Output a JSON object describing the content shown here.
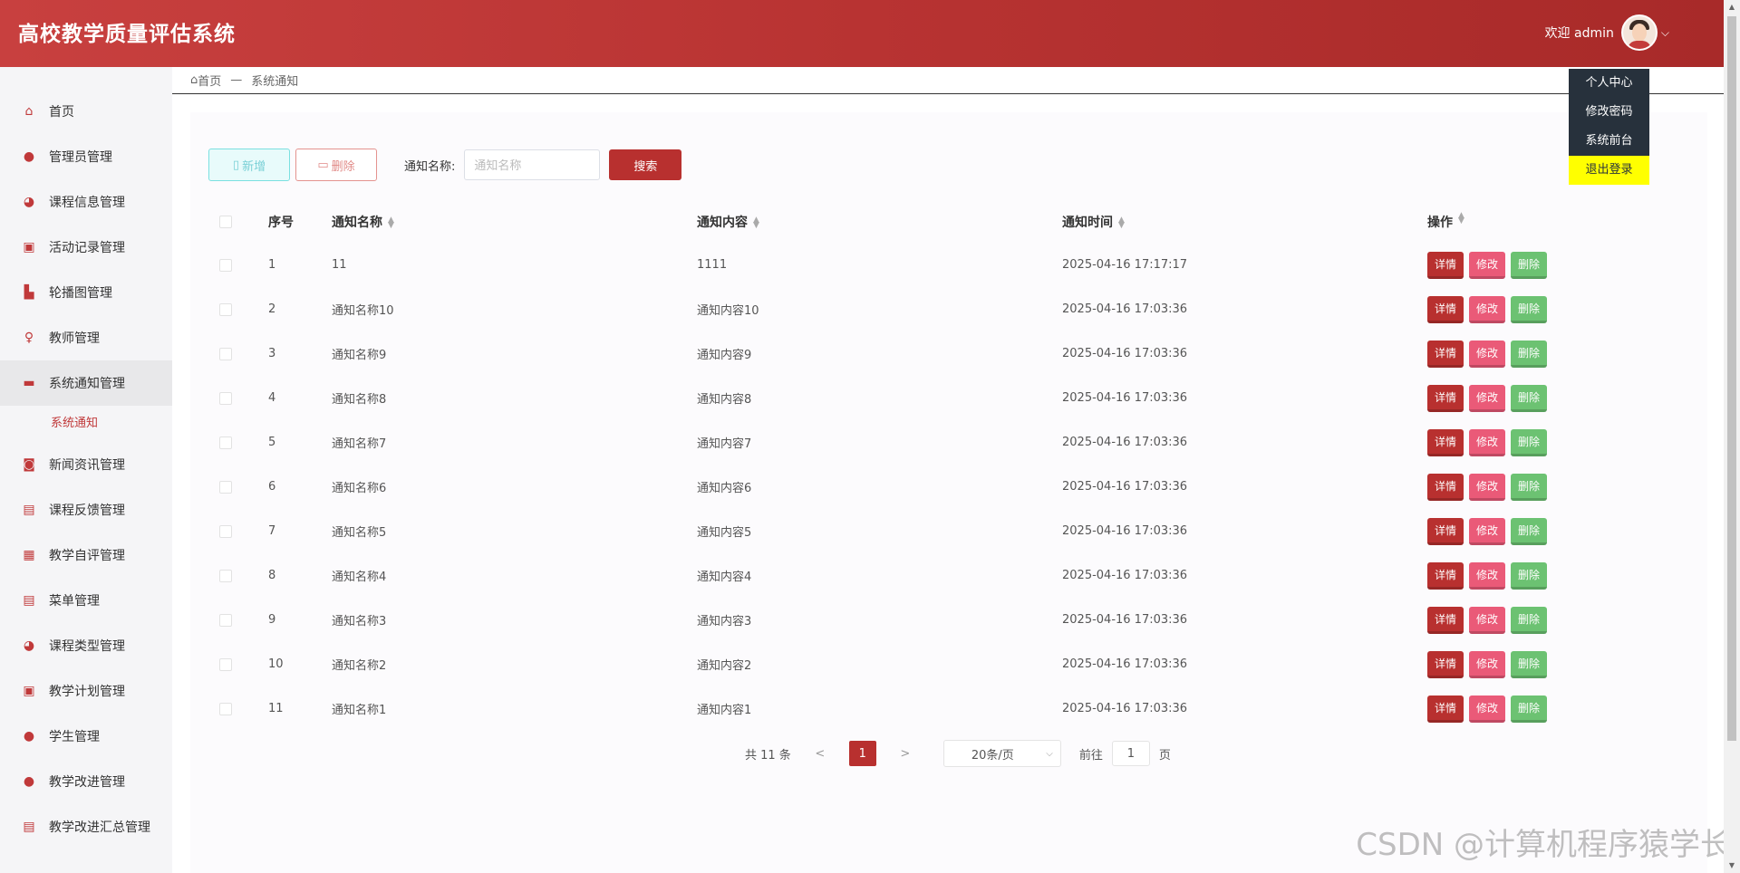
{
  "header": {
    "app_title": "高校教学质量评估系统",
    "welcome": "欢迎 admin",
    "avatar_icon": "user-avatar",
    "chevron": "⌵"
  },
  "user_menu": [
    {
      "label": "个人中心",
      "active": false
    },
    {
      "label": "修改密码",
      "active": false
    },
    {
      "label": "系统前台",
      "active": false
    },
    {
      "label": "退出登录",
      "active": true
    }
  ],
  "sidebar": {
    "items": [
      {
        "label": "首页",
        "icon": "home-icon",
        "glyph": "⌂"
      },
      {
        "label": "管理员管理",
        "icon": "user-icon",
        "glyph": "●"
      },
      {
        "label": "课程信息管理",
        "icon": "pie-icon",
        "glyph": "◕"
      },
      {
        "label": "活动记录管理",
        "icon": "gift-icon",
        "glyph": "▣"
      },
      {
        "label": "轮播图管理",
        "icon": "thumb-icon",
        "glyph": "▙"
      },
      {
        "label": "教师管理",
        "icon": "person-icon",
        "glyph": "♀"
      },
      {
        "label": "系统通知管理",
        "icon": "wallet-icon",
        "glyph": "▬"
      },
      {
        "label": "新闻资讯管理",
        "icon": "chip-icon",
        "glyph": "◙"
      },
      {
        "label": "课程反馈管理",
        "icon": "briefcase-icon",
        "glyph": "▤"
      },
      {
        "label": "教学自评管理",
        "icon": "grid-icon",
        "glyph": "▦"
      },
      {
        "label": "菜单管理",
        "icon": "briefcase-icon",
        "glyph": "▤"
      },
      {
        "label": "课程类型管理",
        "icon": "pie-icon",
        "glyph": "◕"
      },
      {
        "label": "教学计划管理",
        "icon": "gift-icon",
        "glyph": "▣"
      },
      {
        "label": "学生管理",
        "icon": "user-icon",
        "glyph": "●"
      },
      {
        "label": "教学改进管理",
        "icon": "circle-icon",
        "glyph": "●"
      },
      {
        "label": "教学改进汇总管理",
        "icon": "briefcase-icon",
        "glyph": "▤"
      }
    ],
    "active_index": 6,
    "sub_item": "系统通知"
  },
  "breadcrumb": {
    "home": "首页",
    "separator": "—",
    "current": "系统通知"
  },
  "toolbar": {
    "add_label": "新增",
    "delete_label": "删除",
    "search_label": "通知名称:",
    "search_placeholder": "通知名称",
    "search_button": "搜索"
  },
  "table": {
    "headers": {
      "index": "序号",
      "name": "通知名称",
      "content": "通知内容",
      "time": "通知时间",
      "ops": "操作"
    },
    "op_labels": {
      "detail": "详情",
      "edit": "修改",
      "delete": "删除"
    },
    "rows": [
      {
        "index": "1",
        "name": "11",
        "content": "1111",
        "time": "2025-04-16 17:17:17"
      },
      {
        "index": "2",
        "name": "通知名称10",
        "content": "通知内容10",
        "time": "2025-04-16 17:03:36"
      },
      {
        "index": "3",
        "name": "通知名称9",
        "content": "通知内容9",
        "time": "2025-04-16 17:03:36"
      },
      {
        "index": "4",
        "name": "通知名称8",
        "content": "通知内容8",
        "time": "2025-04-16 17:03:36"
      },
      {
        "index": "5",
        "name": "通知名称7",
        "content": "通知内容7",
        "time": "2025-04-16 17:03:36"
      },
      {
        "index": "6",
        "name": "通知名称6",
        "content": "通知内容6",
        "time": "2025-04-16 17:03:36"
      },
      {
        "index": "7",
        "name": "通知名称5",
        "content": "通知内容5",
        "time": "2025-04-16 17:03:36"
      },
      {
        "index": "8",
        "name": "通知名称4",
        "content": "通知内容4",
        "time": "2025-04-16 17:03:36"
      },
      {
        "index": "9",
        "name": "通知名称3",
        "content": "通知内容3",
        "time": "2025-04-16 17:03:36"
      },
      {
        "index": "10",
        "name": "通知名称2",
        "content": "通知内容2",
        "time": "2025-04-16 17:03:36"
      },
      {
        "index": "11",
        "name": "通知名称1",
        "content": "通知内容1",
        "time": "2025-04-16 17:03:36"
      }
    ]
  },
  "pagination": {
    "total": "共 11 条",
    "prev": "<",
    "current": "1",
    "next": ">",
    "page_size": "20条/页",
    "goto_label": "前往",
    "goto_value": "1",
    "page_suffix": "页"
  },
  "watermark": "CSDN @计算机程序猿学长",
  "colors": {
    "header_red": "#b83332",
    "accent": "#b8302f",
    "edit_pink": "#ea5a78",
    "delete_green": "#6cc272",
    "dropdown_bg": "#27313c",
    "dropdown_active": "#ffff00"
  }
}
